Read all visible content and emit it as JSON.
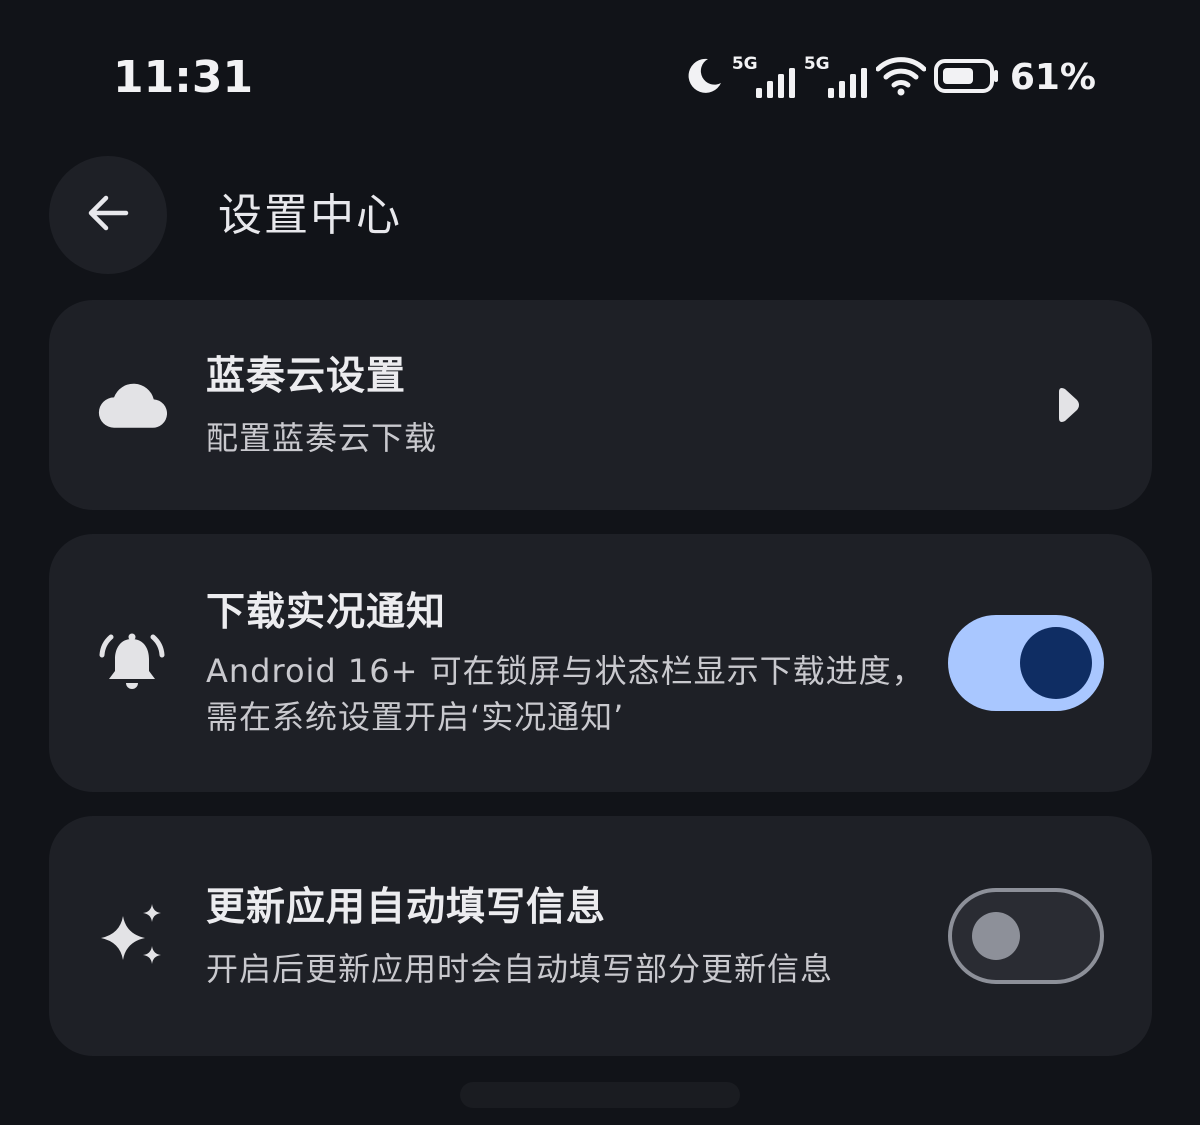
{
  "status_bar": {
    "time": "11:31",
    "network_1": "5G",
    "network_2": "5G",
    "battery_percent": "61%",
    "icons": [
      "moon-icon",
      "signal-icon",
      "signal-icon",
      "wifi-icon",
      "battery-icon"
    ]
  },
  "header": {
    "title": "设置中心",
    "back_icon": "arrow-left-icon"
  },
  "settings": {
    "lanzou": {
      "icon": "cloud-icon",
      "title": "蓝奏云设置",
      "subtitle": "配置蓝奏云下载",
      "trailing_icon": "chevron-right-icon"
    },
    "live_notification": {
      "icon": "bell-ringing-icon",
      "title": "下载实况通知",
      "subtitle": "Android 16+ 可在锁屏与状态栏显示下载进度，需在系统设置开启‘实况通知’",
      "enabled": true
    },
    "autofill": {
      "icon": "sparkles-icon",
      "title": "更新应用自动填写信息",
      "subtitle": "开启后更新应用时会自动填写部分更新信息",
      "enabled": false
    }
  },
  "colors": {
    "background": "#111318",
    "card": "#1e2026",
    "switch_on_track": "#a9c7ff",
    "switch_on_thumb": "#0f2d63",
    "switch_off_outline": "#8d9099"
  }
}
